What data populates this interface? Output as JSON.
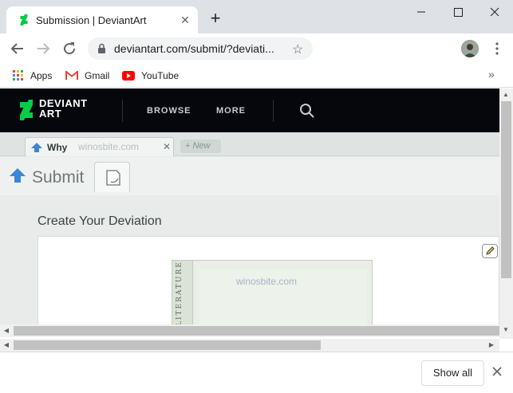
{
  "browser": {
    "tab_title": "Submission | DeviantArt",
    "url": "deviantart.com/submit/?deviati...",
    "bookmarks": [
      {
        "label": "Apps",
        "icon": "apps-grid-icon"
      },
      {
        "label": "Gmail",
        "icon": "gmail-icon"
      },
      {
        "label": "YouTube",
        "icon": "youtube-icon"
      }
    ]
  },
  "site": {
    "logo_line1": "DEVIANT",
    "logo_line2": "ART",
    "nav": [
      "BROWSE",
      "MORE"
    ]
  },
  "page": {
    "tab_label": "Why",
    "watermark": "winosbite.com",
    "new_tab_label": "+ New",
    "submit_title": "Submit",
    "section_title": "Create Your Deviation",
    "card_spine_text": "LITERATURE",
    "card_watermark": "winosbite.com"
  },
  "downloads": {
    "show_all_label": "Show all"
  },
  "colors": {
    "da_green": "#05cc47",
    "da_header_bg": "#06070d",
    "submit_arrow": "#3b86d6"
  }
}
